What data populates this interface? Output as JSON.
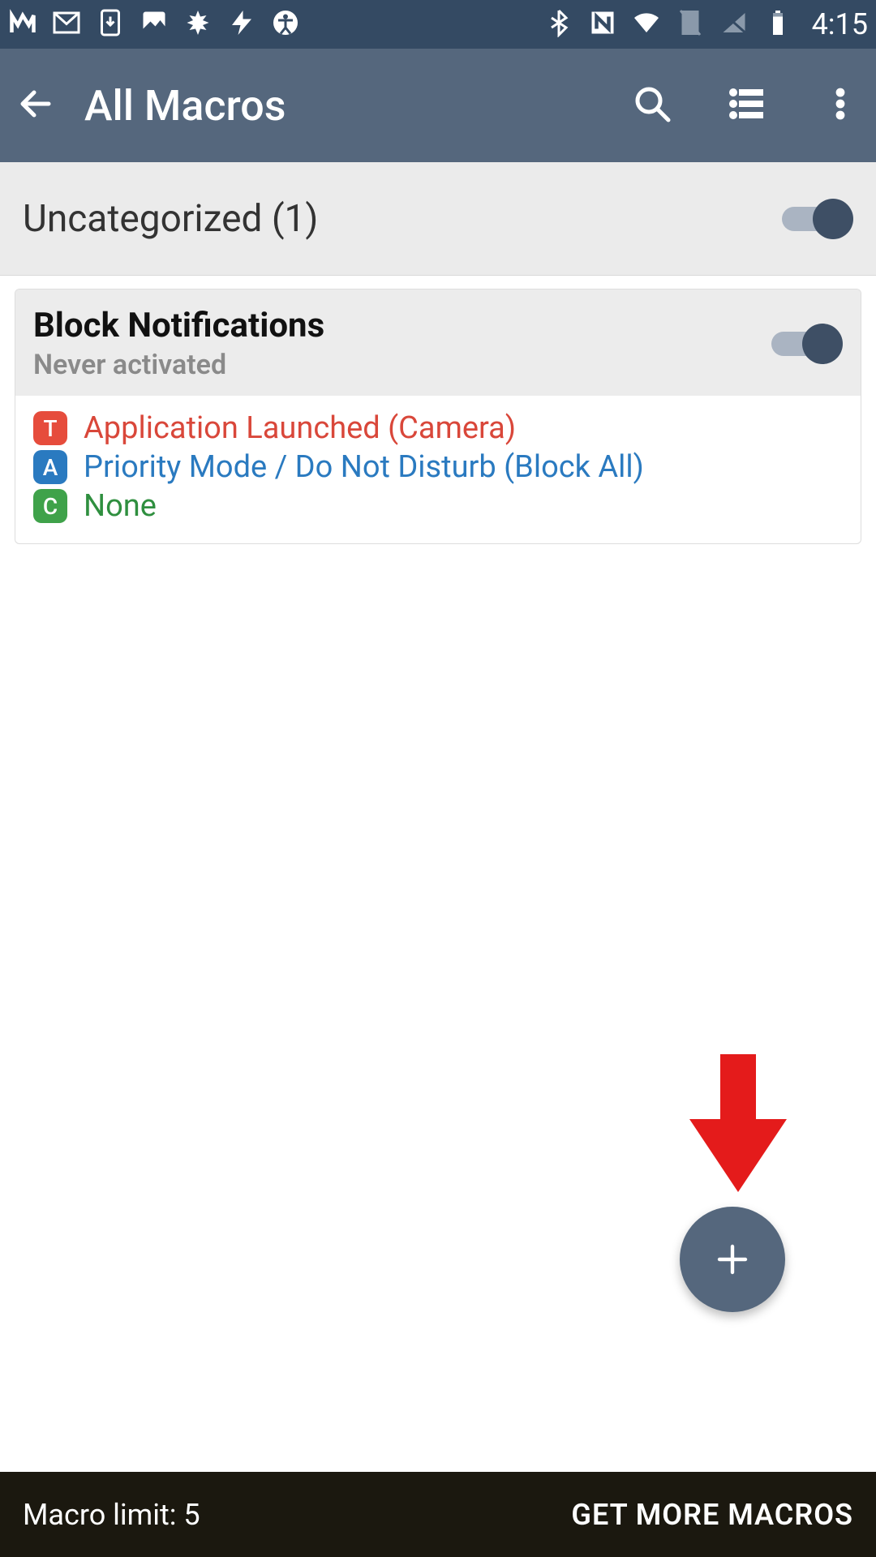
{
  "status": {
    "time": "4:15"
  },
  "appbar": {
    "title": "All Macros"
  },
  "category": {
    "label": "Uncategorized (1)"
  },
  "macro": {
    "name": "Block Notifications",
    "subtitle": "Never activated",
    "trigger": {
      "badge": "T",
      "text": "Application Launched (Camera)"
    },
    "action": {
      "badge": "A",
      "text": "Priority Mode / Do Not Disturb (Block All)"
    },
    "constraint": {
      "badge": "C",
      "text": "None"
    }
  },
  "bottom": {
    "limit": "Macro limit: 5",
    "more": "GET MORE MACROS"
  }
}
